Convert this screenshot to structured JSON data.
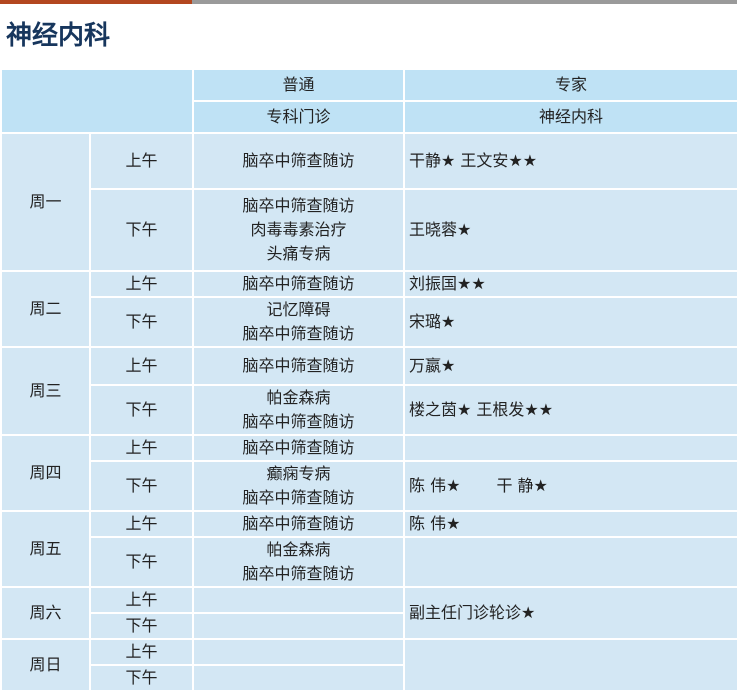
{
  "page": {
    "title": "神经内科",
    "accent_color": "#b3471f",
    "title_color": "#17365d",
    "header_bg": "#bfe2f5",
    "cell_bg": "#d3e7f4"
  },
  "header": {
    "general": "普通",
    "expert": "专家",
    "general_sub": "专科门诊",
    "expert_sub": "神经内科"
  },
  "am": "上午",
  "pm": "下午",
  "rows": {
    "mon": {
      "day": "周一",
      "am": {
        "clinics": [
          "脑卒中筛查随访"
        ],
        "experts": [
          "干静★ 王文安★★"
        ]
      },
      "pm": {
        "clinics": [
          "脑卒中筛查随访",
          "肉毒毒素治疗",
          "头痛专病"
        ],
        "experts": [
          "王晓蓉★"
        ]
      }
    },
    "tue": {
      "day": "周二",
      "am": {
        "clinics": [
          "脑卒中筛查随访"
        ],
        "experts": [
          "刘振国★★"
        ]
      },
      "pm": {
        "clinics": [
          "记忆障碍",
          "脑卒中筛查随访"
        ],
        "experts": [
          "宋璐★"
        ]
      }
    },
    "wed": {
      "day": "周三",
      "am": {
        "clinics": [
          "脑卒中筛查随访"
        ],
        "experts": [
          "万嬴★"
        ]
      },
      "pm": {
        "clinics": [
          "帕金森病",
          "脑卒中筛查随访"
        ],
        "experts": [
          "楼之茵★  王根发★★"
        ]
      }
    },
    "thu": {
      "day": "周四",
      "am": {
        "clinics": [
          "脑卒中筛查随访"
        ],
        "experts": []
      },
      "pm": {
        "clinics": [
          "癫痫专病",
          "脑卒中筛查随访"
        ],
        "experts": [
          "陈 伟★",
          "干 静★"
        ]
      }
    },
    "fri": {
      "day": "周五",
      "am": {
        "clinics": [
          "脑卒中筛查随访"
        ],
        "experts": [
          "陈 伟★"
        ]
      },
      "pm": {
        "clinics": [
          "帕金森病",
          "脑卒中筛查随访"
        ],
        "experts": []
      }
    },
    "sat": {
      "day": "周六",
      "experts": "副主任门诊轮诊★"
    },
    "sun": {
      "day": "周日"
    }
  }
}
